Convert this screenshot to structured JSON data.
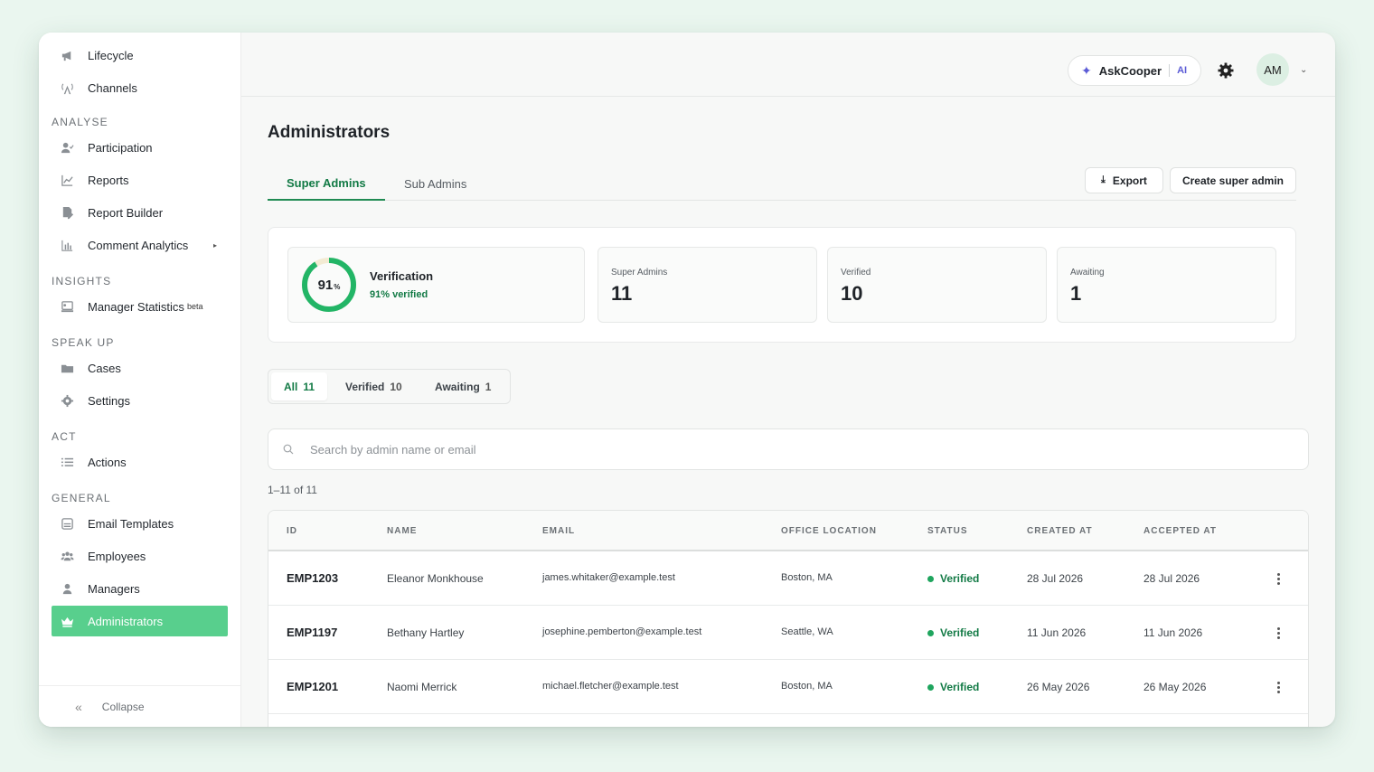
{
  "sidebar": {
    "top_items": [
      {
        "label": "Lifecycle",
        "icon": "megaphone-icon"
      },
      {
        "label": "Channels",
        "icon": "broadcast-icon"
      }
    ],
    "sections": [
      {
        "label": "ANALYSE",
        "items": [
          {
            "label": "Participation",
            "icon": "user-check-icon"
          },
          {
            "label": "Reports",
            "icon": "line-chart-icon"
          },
          {
            "label": "Report Builder",
            "icon": "file-edit-icon"
          },
          {
            "label": "Comment Analytics",
            "icon": "bar-chart-icon"
          }
        ]
      },
      {
        "label": "INSIGHTS",
        "items": [
          {
            "label": "Manager Statistics",
            "badge": "beta",
            "icon": "monitor-icon"
          }
        ]
      },
      {
        "label": "SPEAK UP",
        "items": [
          {
            "label": "Cases",
            "icon": "folder-icon"
          },
          {
            "label": "Settings",
            "icon": "gear-icon"
          }
        ]
      },
      {
        "label": "ACT",
        "items": [
          {
            "label": "Actions",
            "icon": "list-icon"
          }
        ]
      },
      {
        "label": "GENERAL",
        "items": [
          {
            "label": "Email Templates",
            "icon": "email-template-icon"
          },
          {
            "label": "Employees",
            "icon": "users-icon"
          },
          {
            "label": "Managers",
            "icon": "user-icon"
          },
          {
            "label": "Administrators",
            "icon": "crown-icon",
            "active": true
          }
        ]
      }
    ],
    "collapse_label": "Collapse"
  },
  "topbar": {
    "ask_label": "AskCooper",
    "ask_badge": "AI",
    "avatar_initials": "AM"
  },
  "page": {
    "title": "Administrators",
    "tabs": [
      {
        "label": "Super Admins",
        "active": true
      },
      {
        "label": "Sub Admins",
        "active": false
      }
    ],
    "export_label": "Export",
    "create_label": "Create super admin"
  },
  "stats": {
    "verification_percent": 91,
    "verification_percent_text": "91",
    "percent_sign": "%",
    "verification_title": "Verification",
    "verification_sub": "91% verified",
    "cards": [
      {
        "label": "Super Admins",
        "value": "11"
      },
      {
        "label": "Verified",
        "value": "10"
      },
      {
        "label": "Awaiting",
        "value": "1"
      }
    ]
  },
  "filters": [
    {
      "label": "All",
      "count": "11",
      "active": true
    },
    {
      "label": "Verified",
      "count": "10",
      "active": false
    },
    {
      "label": "Awaiting",
      "count": "1",
      "active": false
    }
  ],
  "search": {
    "placeholder": "Search by admin name or email"
  },
  "results_count": "1–11 of 11",
  "table": {
    "columns": [
      "ID",
      "NAME",
      "EMAIL",
      "OFFICE LOCATION",
      "STATUS",
      "CREATED AT",
      "ACCEPTED AT"
    ],
    "rows": [
      {
        "id": "EMP1203",
        "name": "Eleanor Monkhouse",
        "email": "james.whitaker@example.test",
        "location": "Boston, MA",
        "status": "Verified",
        "created": "28 Jul 2026",
        "accepted": "28 Jul 2026"
      },
      {
        "id": "EMP1197",
        "name": "Bethany Hartley",
        "email": "josephine.pemberton@example.test",
        "location": "Seattle, WA",
        "status": "Verified",
        "created": "11 Jun 2026",
        "accepted": "11 Jun 2026"
      },
      {
        "id": "EMP1201",
        "name": "Naomi Merrick",
        "email": "michael.fletcher@example.test",
        "location": "Boston, MA",
        "status": "Verified",
        "created": "26 May 2026",
        "accepted": "26 May 2026"
      }
    ]
  },
  "colors": {
    "accent": "#1f8a52",
    "active_nav": "#58cf8d",
    "ai": "#5b5bd6"
  }
}
